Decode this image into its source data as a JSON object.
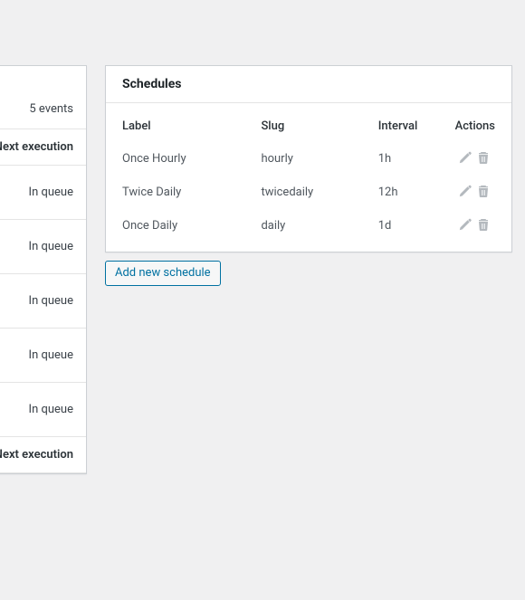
{
  "left_panel": {
    "events_count_label": "5 events",
    "column_header": "Next execution",
    "rows": [
      "In queue",
      "In queue",
      "In queue",
      "In queue",
      "In queue"
    ],
    "footer_header": "Next execution"
  },
  "schedules_panel": {
    "title": "Schedules",
    "columns": {
      "label": "Label",
      "slug": "Slug",
      "interval": "Interval",
      "actions": "Actions"
    },
    "rows": [
      {
        "label": "Once Hourly",
        "slug": "hourly",
        "interval": "1h"
      },
      {
        "label": "Twice Daily",
        "slug": "twicedaily",
        "interval": "12h"
      },
      {
        "label": "Once Daily",
        "slug": "daily",
        "interval": "1d"
      }
    ]
  },
  "add_button_label": "Add new schedule"
}
